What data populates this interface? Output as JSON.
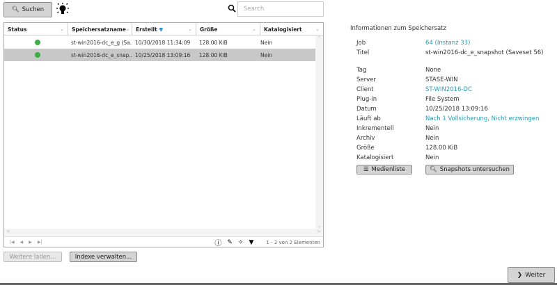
{
  "toolbar": {
    "search_button": "Suchen",
    "search_placeholder": "Search"
  },
  "grid": {
    "columns": [
      "Status",
      "Speichersatzname",
      "Erstellt",
      "Größe",
      "Katalogisiert"
    ],
    "rows": [
      {
        "status": "green",
        "name": "st-win2016-dc_e_g (Sa...",
        "created": "10/30/2018 11:34:09",
        "size": "128.00 KiB",
        "cataloged": "Nein"
      },
      {
        "status": "green",
        "name": "st-win2016-dc_e_snap...",
        "created": "10/25/2018 13:09:16",
        "size": "128.00 KiB",
        "cataloged": "Nein"
      }
    ],
    "pager_text": "1 - 2 von 2 Elementen"
  },
  "buttons": {
    "load_more": "Weitere laden...",
    "manage_index": "Indexe verwalten...",
    "next": "Weiter",
    "media_list": "Medienliste",
    "snapshots": "Snapshots untersuchen"
  },
  "info": {
    "title": "Informationen zum Speichersatz",
    "fields": [
      {
        "k": "Job",
        "v": "64 (Instanz 33)",
        "link": true
      },
      {
        "k": "Titel",
        "v": "st-win2016-dc_e_snapshot (Saveset 56)"
      },
      {
        "k": "Tag",
        "v": "None"
      },
      {
        "k": "Server",
        "v": "STASE-WIN"
      },
      {
        "k": "Client",
        "v": "ST-WIN2016-DC",
        "link": true
      },
      {
        "k": "Plug-in",
        "v": "File System"
      },
      {
        "k": "Datum",
        "v": "10/25/2018 13:09:16"
      },
      {
        "k": "Läuft ab",
        "v": "Nach 1 Vollsicherung, Nicht erzwingen",
        "link": true
      },
      {
        "k": "Inkrementell",
        "v": "Nein"
      },
      {
        "k": "Archiv",
        "v": "Nein"
      },
      {
        "k": "Größe",
        "v": "128.00 KiB"
      },
      {
        "k": "Katalogisiert",
        "v": "Nein"
      }
    ]
  },
  "colors": {
    "accent": "#2a9cb3",
    "status_ok": "#3fad46",
    "selected_row": "#c8c8c8"
  }
}
